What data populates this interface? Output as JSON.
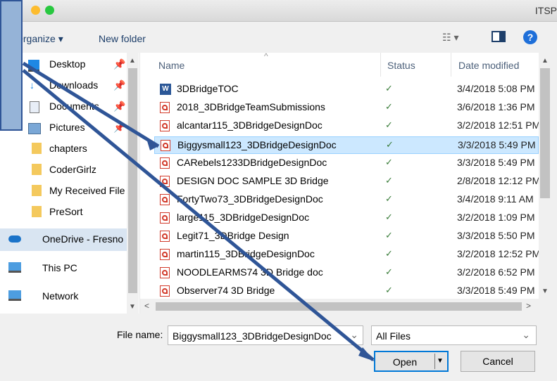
{
  "window": {
    "title": "ITSP"
  },
  "toolbar": {
    "organize_label": "Organize ▾",
    "new_folder_label": "New folder"
  },
  "nav": {
    "items": [
      {
        "label": "Desktop",
        "pinned": true
      },
      {
        "label": "Downloads",
        "pinned": true
      },
      {
        "label": "Documents",
        "pinned": true
      },
      {
        "label": "Pictures",
        "pinned": true
      },
      {
        "label": "chapters"
      },
      {
        "label": "CoderGirlz"
      },
      {
        "label": "My Received File"
      },
      {
        "label": "PreSort"
      },
      {
        "label": "OneDrive - Fresno"
      },
      {
        "label": "This PC"
      },
      {
        "label": "Network"
      }
    ]
  },
  "columns": {
    "name": "Name",
    "status": "Status",
    "date": "Date modified"
  },
  "files": [
    {
      "name": "3DBridgeTOC",
      "type": "word",
      "status": "✓",
      "date": "3/4/2018 5:08 PM"
    },
    {
      "name": "2018_3DBridgeTeamSubmissions",
      "type": "pdf",
      "status": "✓",
      "date": "3/6/2018 1:36 PM"
    },
    {
      "name": "alcantar115_3DBridgeDesignDoc",
      "type": "pdf",
      "status": "✓",
      "date": "3/2/2018 12:51 PM"
    },
    {
      "name": "Biggysmall123_3DBridgeDesignDoc",
      "type": "pdf",
      "status": "✓",
      "date": "3/3/2018 5:49 PM",
      "selected": true
    },
    {
      "name": "CARebels1233DBridgeDesignDoc",
      "type": "pdf",
      "status": "✓",
      "date": "3/3/2018 5:49 PM"
    },
    {
      "name": "DESIGN DOC SAMPLE 3D Bridge",
      "type": "pdf",
      "status": "✓",
      "date": "2/8/2018 12:12 PM"
    },
    {
      "name": "FortyTwo73_3DBridgeDesignDoc",
      "type": "pdf",
      "status": "✓",
      "date": "3/4/2018 9:11 AM"
    },
    {
      "name": "large115_3DBridgeDesignDoc",
      "type": "pdf",
      "status": "✓",
      "date": "3/2/2018 1:09 PM"
    },
    {
      "name": "Legit71_3DBridge Design",
      "type": "pdf",
      "status": "✓",
      "date": "3/3/2018 5:50 PM"
    },
    {
      "name": "martin115_3DBridgeDesignDoc",
      "type": "pdf",
      "status": "✓",
      "date": "3/2/2018 12:52 PM"
    },
    {
      "name": "NOODLEARMS74 3D Bridge doc",
      "type": "pdf",
      "status": "✓",
      "date": "3/2/2018 6:52 PM"
    },
    {
      "name": "Observer74 3D Bridge",
      "type": "pdf",
      "status": "✓",
      "date": "3/3/2018 5:49 PM"
    }
  ],
  "bottom": {
    "filename_label": "File name:",
    "filename_value": "Biggysmall123_3DBridgeDesignDoc",
    "filetype_value": "All Files",
    "open_label": "Open",
    "cancel_label": "Cancel"
  },
  "colors": {
    "accent": "#2f5597",
    "selection": "#cce8ff",
    "callout": "#95b3d7",
    "link": "#1e3f6a"
  }
}
